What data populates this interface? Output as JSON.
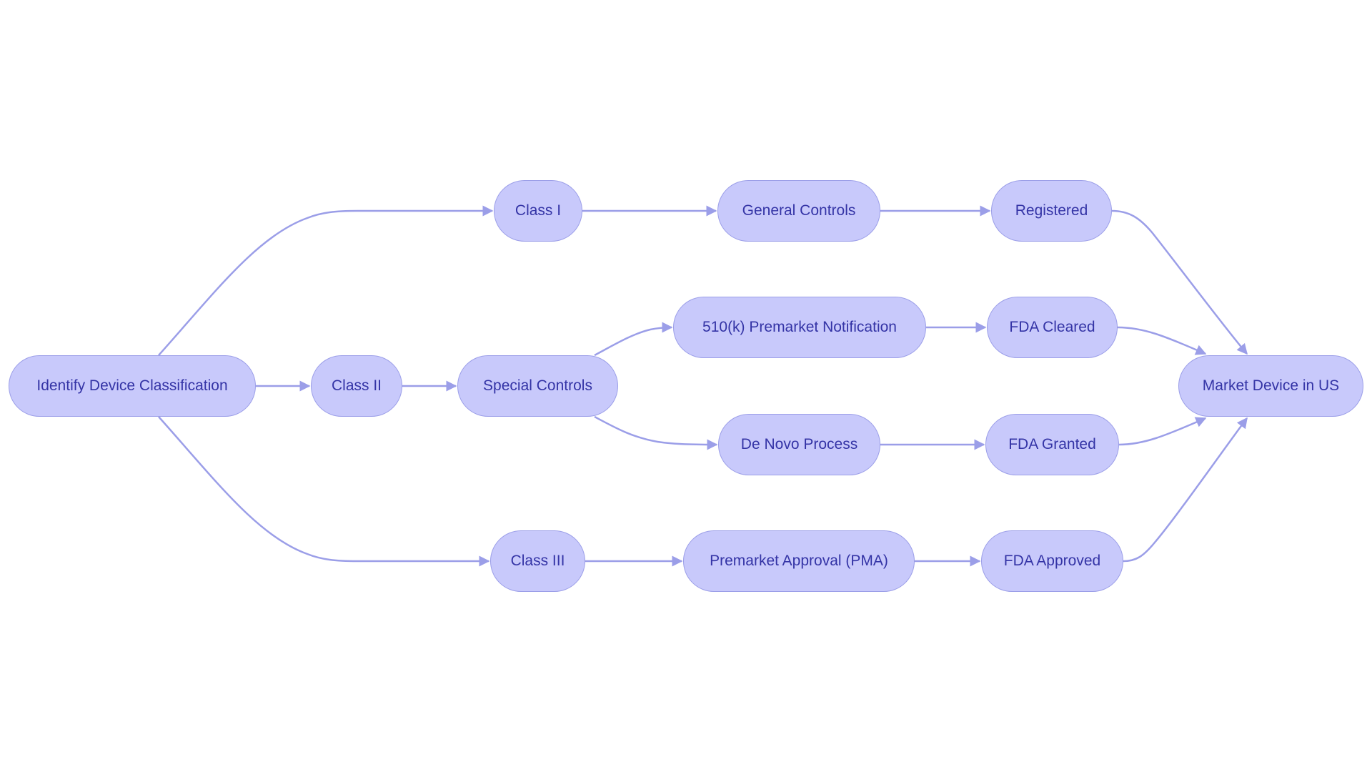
{
  "diagram": {
    "type": "flowchart",
    "direction": "left-to-right",
    "colors": {
      "node_fill": "#c8c9fb",
      "node_stroke": "#9b9ee8",
      "edge": "#9b9ee8",
      "text": "#3434a6",
      "background": "#ffffff"
    },
    "nodes": {
      "identify": "Identify Device Classification",
      "class1": "Class I",
      "class2": "Class II",
      "class3": "Class III",
      "general": "General Controls",
      "special": "Special Controls",
      "pn510k": "510(k) Premarket Notification",
      "denovo": "De Novo Process",
      "pma": "Premarket Approval (PMA)",
      "registered": "Registered",
      "cleared": "FDA Cleared",
      "granted": "FDA Granted",
      "approved": "FDA Approved",
      "market": "Market Device in US"
    },
    "edges": [
      {
        "from": "identify",
        "to": "class1"
      },
      {
        "from": "identify",
        "to": "class2"
      },
      {
        "from": "identify",
        "to": "class3"
      },
      {
        "from": "class1",
        "to": "general"
      },
      {
        "from": "general",
        "to": "registered"
      },
      {
        "from": "class2",
        "to": "special"
      },
      {
        "from": "special",
        "to": "pn510k"
      },
      {
        "from": "special",
        "to": "denovo"
      },
      {
        "from": "pn510k",
        "to": "cleared"
      },
      {
        "from": "denovo",
        "to": "granted"
      },
      {
        "from": "class3",
        "to": "pma"
      },
      {
        "from": "pma",
        "to": "approved"
      },
      {
        "from": "registered",
        "to": "market"
      },
      {
        "from": "cleared",
        "to": "market"
      },
      {
        "from": "granted",
        "to": "market"
      },
      {
        "from": "approved",
        "to": "market"
      }
    ]
  }
}
